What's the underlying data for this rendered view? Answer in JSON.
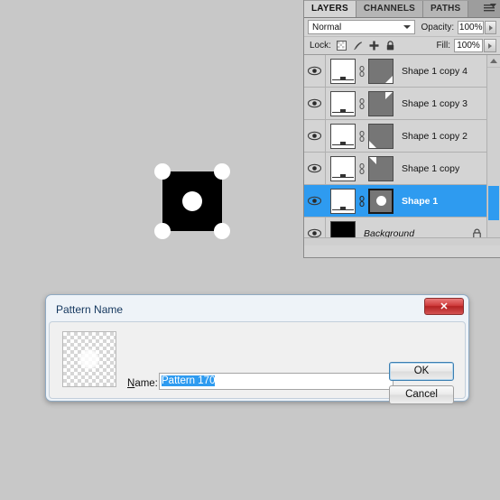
{
  "canvas": {
    "artwork_name": "pattern-tile-preview",
    "shape_colors": {
      "fill": "#000000",
      "dots": "#ffffff",
      "background": "#ffffff"
    },
    "page_background": "#c8c8c8"
  },
  "layers_panel": {
    "tabs": [
      {
        "label": "LAYERS",
        "active": true
      },
      {
        "label": "CHANNELS",
        "active": false
      },
      {
        "label": "PATHS",
        "active": false
      }
    ],
    "blend_mode": "Normal",
    "opacity": {
      "label": "Opacity:",
      "value": "100%"
    },
    "fill": {
      "label": "Fill:",
      "value": "100%"
    },
    "lock": {
      "label": "Lock:",
      "icons": [
        "lock-transparent-pixels-icon",
        "lock-image-pixels-icon",
        "lock-position-icon",
        "lock-all-icon"
      ]
    },
    "layers": [
      {
        "name": "Shape 1 copy 4",
        "selected": false,
        "visible": true,
        "type": "shape",
        "mask_corner": "br",
        "locked": false
      },
      {
        "name": "Shape 1 copy 3",
        "selected": false,
        "visible": true,
        "type": "shape",
        "mask_corner": "tr",
        "locked": false
      },
      {
        "name": "Shape 1 copy 2",
        "selected": false,
        "visible": true,
        "type": "shape",
        "mask_corner": "bl",
        "locked": false
      },
      {
        "name": "Shape 1 copy",
        "selected": false,
        "visible": true,
        "type": "shape",
        "mask_corner": "tl",
        "locked": false
      },
      {
        "name": "Shape 1",
        "selected": true,
        "visible": true,
        "type": "shape",
        "mask_corner": "dot",
        "locked": false
      },
      {
        "name": "Background",
        "selected": false,
        "visible": true,
        "type": "background",
        "mask_corner": "none",
        "locked": true
      }
    ],
    "selection_color": "#2e9bf0"
  },
  "dialog": {
    "title": "Pattern Name",
    "close_label": "✕",
    "name_label_prefix": "",
    "name_label_underlined": "N",
    "name_label_suffix": "ame:",
    "name_value": "Pattern 170",
    "buttons": {
      "ok": "OK",
      "cancel": "Cancel"
    },
    "preview_name": "pattern-preview-thumbnail"
  }
}
